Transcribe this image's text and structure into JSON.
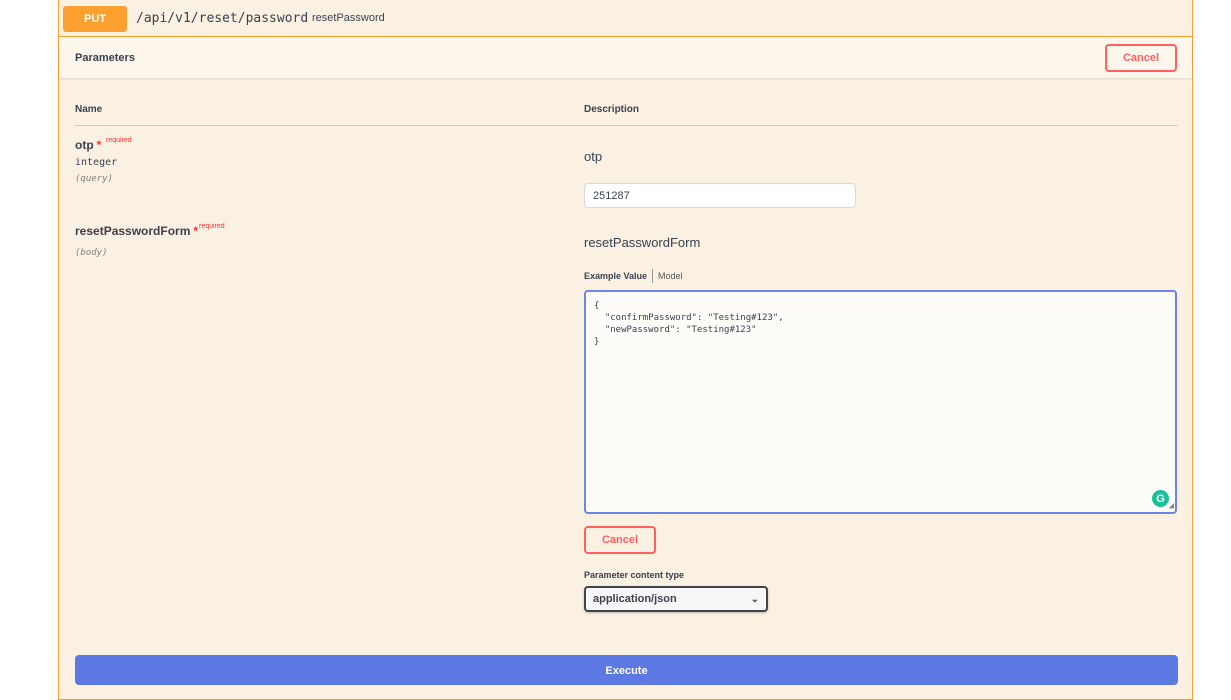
{
  "operation": {
    "method": "PUT",
    "path": "/api/v1/reset/password",
    "operation_id": "resetPassword"
  },
  "parameters_section": {
    "title": "Parameters",
    "cancel_label": "Cancel",
    "col_name": "Name",
    "col_description": "Description"
  },
  "params": [
    {
      "name": "otp",
      "required_label": "required",
      "required_star": "*",
      "type": "integer",
      "in": "(query)",
      "description": "otp",
      "value": "251287"
    },
    {
      "name": "resetPasswordForm",
      "required_label": "required",
      "required_star": "*",
      "in": "(body)",
      "description": "resetPasswordForm",
      "tab_active": "Example Value",
      "tab_other": "Model",
      "body_value": "{\n  \"confirmPassword\": \"Testing#123\",\n  \"newPassword\": \"Testing#123\"\n}",
      "cancel_label": "Cancel",
      "content_type_label": "Parameter content type",
      "content_type_value": "application/json"
    }
  ],
  "execute_label": "Execute",
  "colors": {
    "method_put": "#fca130",
    "cancel": "#ff6060",
    "execute": "#5c78e3"
  }
}
